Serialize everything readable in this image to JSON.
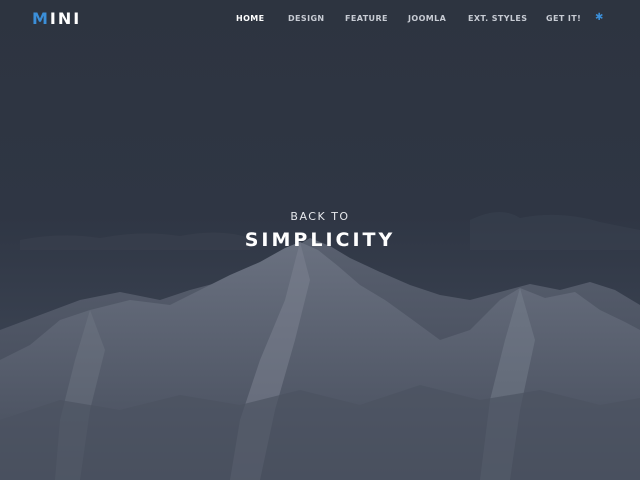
{
  "brand": {
    "logo_first_letter": "M",
    "logo_rest": "INI"
  },
  "nav": {
    "items": [
      {
        "label": "HOME",
        "active": true
      },
      {
        "label": "DESIGN",
        "active": false
      },
      {
        "label": "FEATURE",
        "active": false
      },
      {
        "label": "JOOMLA",
        "active": false
      },
      {
        "label": "EXT. STYLES",
        "active": false
      },
      {
        "label": "GET IT!",
        "active": false
      }
    ],
    "extra_icon": "asterisk-icon"
  },
  "hero": {
    "subtitle": "BACK TO",
    "title": "SIMPLICITY",
    "background": "mountain-landscape"
  },
  "colors": {
    "accent": "#3b8fd9",
    "background": "#2d3340",
    "text": "#ffffff"
  }
}
